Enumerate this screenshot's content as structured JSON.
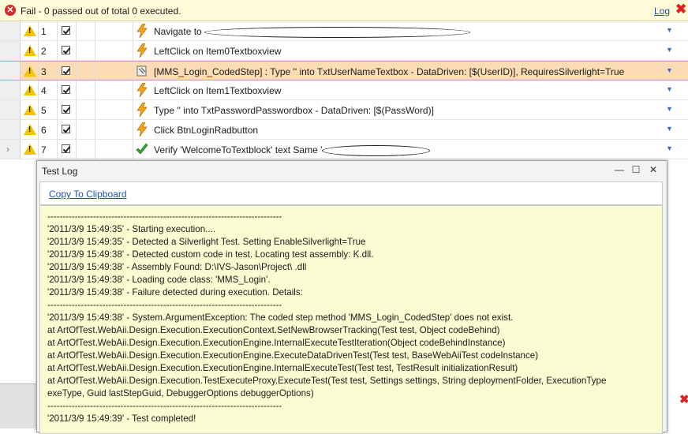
{
  "status": {
    "text": "Fail - 0 passed out of total 0 executed.",
    "log_link": "Log",
    "close_icon": "close-icon"
  },
  "steps": [
    {
      "num": "1",
      "icon": "lightning-icon",
      "desc_before": "Navigate to ",
      "redacted": true,
      "selected": false,
      "arrow": false
    },
    {
      "num": "2",
      "icon": "lightning-icon",
      "desc_before": "LeftClick on Item0Textboxview",
      "redacted": false,
      "selected": false,
      "arrow": false
    },
    {
      "num": "3",
      "icon": "coded-step-icon",
      "desc_before": "[MMS_Login_CodedStep] : Type '' into TxtUserNameTextbox - DataDriven: [$(UserID)], RequiresSilverlight=True",
      "redacted": false,
      "selected": true,
      "arrow": false
    },
    {
      "num": "4",
      "icon": "lightning-icon",
      "desc_before": "LeftClick on Item1Textboxview",
      "redacted": false,
      "selected": false,
      "arrow": false
    },
    {
      "num": "5",
      "icon": "lightning-icon",
      "desc_before": "Type '' into TxtPasswordPasswordbox - DataDriven: [$(PassWord)]",
      "redacted": false,
      "selected": false,
      "arrow": false
    },
    {
      "num": "6",
      "icon": "lightning-icon",
      "desc_before": "Click BtnLoginRadbutton",
      "redacted": false,
      "selected": false,
      "arrow": false
    },
    {
      "num": "7",
      "icon": "checkmark-icon",
      "desc_before": "Verify 'WelcomeToTextblock' text Same '",
      "redacted": true,
      "selected": false,
      "arrow": true
    }
  ],
  "log_window": {
    "title": "Test Log",
    "copy_link": "Copy To Clipboard",
    "lines": [
      "-----------------------------------------------------------------------------",
      "'2011/3/9 15:49:35' - Starting execution....",
      "'2011/3/9 15:49:35' - Detected a Silverlight Test. Setting EnableSilverlight=True",
      "'2011/3/9 15:49:38' - Detected custom code in test. Locating test assembly: K.dll.",
      "'2011/3/9 15:49:38' - Assembly Found: D:\\IVS-Jason\\Project\\ .dll",
      "'2011/3/9 15:49:38' - Loading code class: 'MMS_Login'.",
      "'2011/3/9 15:49:38' - Failure detected during execution. Details:",
      "-----------------------------------------------------------------------------",
      "'2011/3/9 15:49:38' - System.ArgumentException: The coded step method 'MMS_Login_CodedStep' does not exist.",
      "   at ArtOfTest.WebAii.Design.Execution.ExecutionContext.SetNewBrowserTracking(Test test, Object codeBehind)",
      "   at ArtOfTest.WebAii.Design.Execution.ExecutionEngine.InternalExecuteTestIteration(Object codeBehindInstance)",
      "   at ArtOfTest.WebAii.Design.Execution.ExecutionEngine.ExecuteDataDrivenTest(Test test, BaseWebAiiTest codeInstance)",
      "   at ArtOfTest.WebAii.Design.Execution.ExecutionEngine.InternalExecuteTest(Test test, TestResult initializationResult)",
      "   at ArtOfTest.WebAii.Design.Execution.TestExecuteProxy.ExecuteTest(Test test, Settings settings, String deploymentFolder, ExecutionType",
      "exeType, Guid lastStepGuid, DebuggerOptions debuggerOptions)",
      "-----------------------------------------------------------------------------",
      "'2011/3/9 15:49:39' - Test completed!"
    ]
  },
  "colors": {
    "status_bg": "#fffbd8",
    "selected_row": "#fbdcb4",
    "log_bg": "#fbfbd2",
    "link": "#1f4fb5",
    "error": "#d62a2a"
  }
}
